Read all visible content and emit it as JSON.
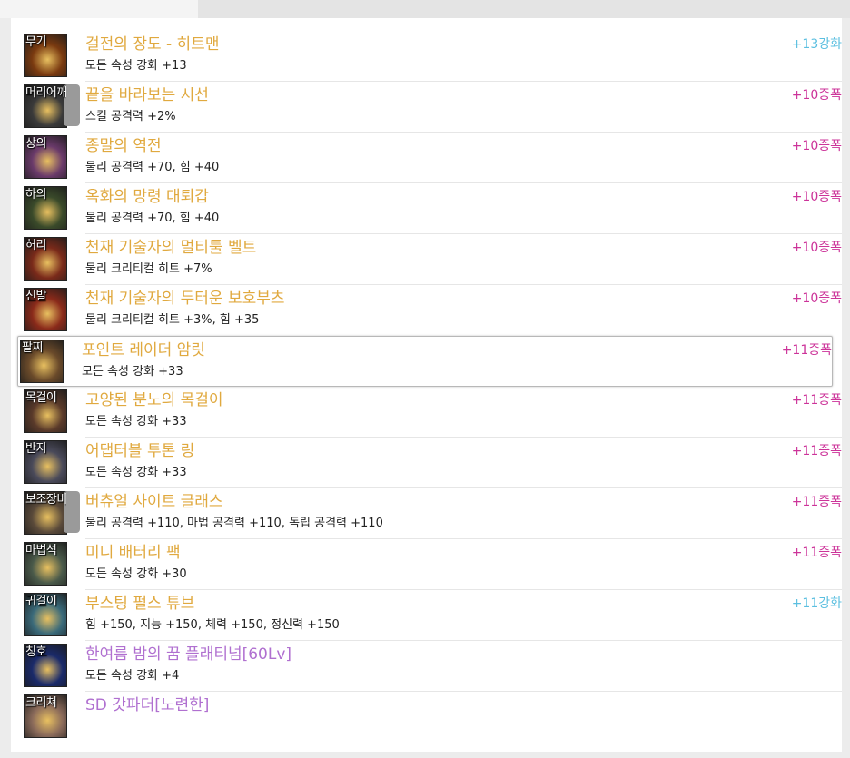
{
  "colors": {
    "item_name": "#e0a93f",
    "item_name_purple": "#b070d0",
    "amplify": "#cc3399",
    "enhance": "#5bbfe0"
  },
  "equipment": [
    {
      "slot": "무기",
      "name": "걸전의 장도 - 히트맨",
      "detail": "모든 속성 강화 +13",
      "badge": "+13강화",
      "badge_type": "enhance",
      "icon": "weapon-icon",
      "icon_color": "#7a3a10"
    },
    {
      "slot": "머리어깨",
      "name": "끝을 바라보는 시선",
      "detail": "스킬 공격력 +2%",
      "badge": "+10증폭",
      "badge_type": "amplify",
      "icon": "shoulder-icon",
      "icon_color": "#3a3a3a"
    },
    {
      "slot": "상의",
      "name": "종말의 역전",
      "detail": "물리 공격력 +70, 힘 +40",
      "badge": "+10증폭",
      "badge_type": "amplify",
      "icon": "top-icon",
      "icon_color": "#6a3a6a"
    },
    {
      "slot": "하의",
      "name": "옥화의 망령 대퇴갑",
      "detail": "물리 공격력 +70, 힘 +40",
      "badge": "+10증폭",
      "badge_type": "amplify",
      "icon": "pants-icon",
      "icon_color": "#3a4a2a"
    },
    {
      "slot": "허리",
      "name": "천재 기술자의 멀티툴 벨트",
      "detail": "물리 크리티컬 히트 +7%",
      "badge": "+10증폭",
      "badge_type": "amplify",
      "icon": "belt-icon",
      "icon_color": "#7a2a1a"
    },
    {
      "slot": "신발",
      "name": "천재 기술자의 두터운 보호부츠",
      "detail": "물리 크리티컬 히트 +3%, 힘 +35",
      "badge": "+10증폭",
      "badge_type": "amplify",
      "icon": "boots-icon",
      "icon_color": "#8a2a1a"
    },
    {
      "slot": "팔찌",
      "name": "포인트 레이더 암릿",
      "detail": "모든 속성 강화 +33",
      "badge": "+11증폭",
      "badge_type": "amplify",
      "icon": "bracelet-icon",
      "icon_color": "#6a4a2a"
    },
    {
      "slot": "목걸이",
      "name": "고양된 분노의 목걸이",
      "detail": "모든 속성 강화 +33",
      "badge": "+11증폭",
      "badge_type": "amplify",
      "icon": "necklace-icon",
      "icon_color": "#5a3a2a"
    },
    {
      "slot": "반지",
      "name": "어댑터블 투톤 링",
      "detail": "모든 속성 강화 +33",
      "badge": "+11증폭",
      "badge_type": "amplify",
      "icon": "ring-icon",
      "icon_color": "#4a4a5a"
    },
    {
      "slot": "보조장비",
      "name": "버츄얼 사이트 글래스",
      "detail": "물리 공격력 +110, 마법 공격력 +110, 독립 공격력 +110",
      "badge": "+11증폭",
      "badge_type": "amplify",
      "icon": "goggles-icon",
      "icon_color": "#5a4a3a"
    },
    {
      "slot": "마법석",
      "name": "미니 배터리 팩",
      "detail": "모든 속성 강화 +30",
      "badge": "+11증폭",
      "badge_type": "amplify",
      "icon": "battery-icon",
      "icon_color": "#4a5a4a"
    },
    {
      "slot": "귀걸이",
      "name": "부스팅 펄스 튜브",
      "detail": "힘 +150, 지능 +150, 체력 +150, 정신력 +150",
      "badge": "+11강화",
      "badge_type": "enhance",
      "icon": "earring-icon",
      "icon_color": "#3a6a7a"
    },
    {
      "slot": "칭호",
      "name": "한여름 밤의 꿈 플래티넘[60Lv]",
      "detail": "모든 속성 강화 +4",
      "badge": "",
      "badge_type": "none",
      "icon": "title-icon",
      "icon_color": "#1a2a6a",
      "name_color": "purple"
    },
    {
      "slot": "크리쳐",
      "name": "SD 갓파더[노련한]",
      "detail": "",
      "badge": "",
      "badge_type": "none",
      "icon": "creature-icon",
      "icon_color": "#8a6a5a",
      "name_color": "purple"
    }
  ]
}
